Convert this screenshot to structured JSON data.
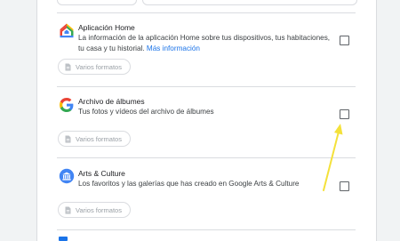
{
  "items": [
    {
      "title": "Aplicación Home",
      "description": "La información de la aplicación Home sobre tus dispositivos, tus habitaciones, tu casa y tu historial.",
      "more_link": "Más información",
      "format_chip": "Varios formatos",
      "icon": "google-home-icon",
      "checked": false
    },
    {
      "title": "Archivo de álbumes",
      "description": "Tus fotos y vídeos del archivo de álbumes",
      "format_chip": "Varios formatos",
      "icon": "google-g-icon",
      "checked": false
    },
    {
      "title": "Arts & Culture",
      "description": "Los favoritos y las galerías que has creado en Google Arts & Culture",
      "format_chip": "Varios formatos",
      "icon": "arts-culture-icon",
      "checked": false
    }
  ],
  "colors": {
    "link": "#1a73e8",
    "annotation_arrow": "#f4e13a",
    "divider": "#dadce0"
  }
}
